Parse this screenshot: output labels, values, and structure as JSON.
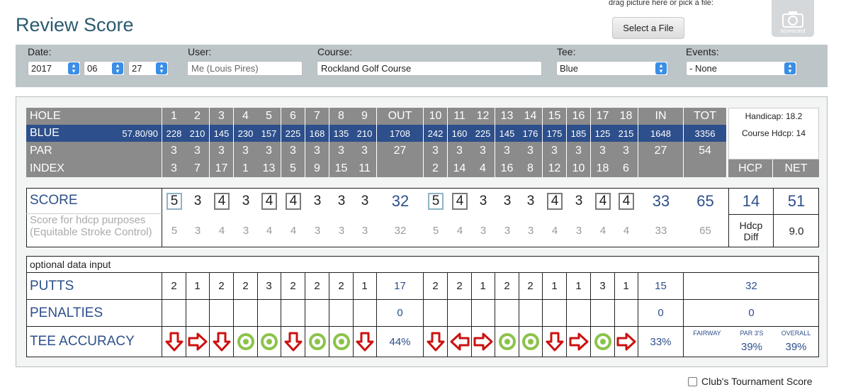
{
  "page": {
    "title": "Review Score"
  },
  "upload": {
    "drag_text": "drag picture here or pick a file:",
    "select_label": "Select a File",
    "camera_label": "scorecard"
  },
  "filters": {
    "date_label": "Date:",
    "year": "2017",
    "month": "06",
    "day": "27",
    "user_label": "User:",
    "user_value": "Me (Louis Pires)",
    "course_label": "Course:",
    "course_value": "Rockland Golf Course",
    "tee_label": "Tee:",
    "tee_value": "Blue",
    "events_label": "Events:",
    "events_value": "- None"
  },
  "card": {
    "hole_label": "HOLE",
    "holes_front": [
      "1",
      "2",
      "3",
      "4",
      "5",
      "6",
      "7",
      "8",
      "9"
    ],
    "out_label": "OUT",
    "holes_back": [
      "10",
      "11",
      "12",
      "13",
      "14",
      "15",
      "16",
      "17",
      "18"
    ],
    "in_label": "IN",
    "tot_label": "TOT",
    "tee_label": "BLUE",
    "rating": "57.80/90",
    "yards_front": [
      "228",
      "210",
      "145",
      "230",
      "157",
      "225",
      "168",
      "135",
      "210"
    ],
    "yards_out": "1708",
    "yards_back": [
      "242",
      "160",
      "225",
      "145",
      "176",
      "175",
      "185",
      "125",
      "215"
    ],
    "yards_in": "1648",
    "yards_tot": "3356",
    "par_label": "PAR",
    "par_front": [
      "3",
      "3",
      "3",
      "3",
      "3",
      "3",
      "3",
      "3",
      "3"
    ],
    "par_out": "27",
    "par_back": [
      "3",
      "3",
      "3",
      "3",
      "3",
      "3",
      "3",
      "3",
      "3"
    ],
    "par_in": "27",
    "par_tot": "54",
    "index_label": "INDEX",
    "index_front": [
      "3",
      "7",
      "17",
      "1",
      "13",
      "5",
      "9",
      "15",
      "11"
    ],
    "index_back": [
      "2",
      "14",
      "4",
      "16",
      "8",
      "12",
      "10",
      "18",
      "6"
    ],
    "handicap": "Handicap: 18.2",
    "course_hdcp": "Course Hdcp: 14",
    "hcp_label": "HCP",
    "net_label": "NET"
  },
  "score": {
    "label": "SCORE",
    "front": [
      "5",
      "3",
      "4",
      "3",
      "4",
      "4",
      "3",
      "3",
      "3"
    ],
    "out": "32",
    "back": [
      "5",
      "4",
      "3",
      "3",
      "3",
      "4",
      "3",
      "4",
      "4"
    ],
    "in": "33",
    "tot": "65",
    "hcp": "14",
    "net": "51",
    "hdcp_label_1": "Score for hdcp purposes",
    "hdcp_label_2": "(Equitable Stroke Control)",
    "esc_front": [
      "5",
      "3",
      "4",
      "3",
      "4",
      "4",
      "3",
      "3",
      "3"
    ],
    "esc_out": "32",
    "esc_back": [
      "5",
      "4",
      "3",
      "3",
      "3",
      "4",
      "3",
      "4",
      "4"
    ],
    "esc_in": "33",
    "esc_tot": "65",
    "hdcp_diff_label_1": "Hdcp",
    "hdcp_diff_label_2": "Diff",
    "hdcp_diff": "9.0",
    "box_styles_front": [
      "birdie",
      "none",
      "box",
      "none",
      "box",
      "box",
      "none",
      "none",
      "none"
    ],
    "box_styles_back": [
      "birdie",
      "box",
      "none",
      "none",
      "none",
      "box",
      "none",
      "box",
      "box"
    ]
  },
  "optional": {
    "header": "optional data input",
    "putts_label": "PUTTS",
    "putts_front": [
      "2",
      "1",
      "2",
      "2",
      "3",
      "2",
      "2",
      "2",
      "1"
    ],
    "putts_out": "17",
    "putts_back": [
      "2",
      "2",
      "1",
      "2",
      "2",
      "1",
      "1",
      "3",
      "1"
    ],
    "putts_in": "15",
    "putts_tot": "32",
    "penalties_label": "PENALTIES",
    "pen_out": "0",
    "pen_in": "0",
    "pen_tot": "0",
    "tee_acc_label": "TEE ACCURACY",
    "acc_front": [
      "down",
      "right",
      "down",
      "hit",
      "hit",
      "down",
      "hit",
      "hit",
      "down"
    ],
    "acc_out": "44%",
    "acc_back": [
      "down",
      "left",
      "right",
      "hit",
      "hit",
      "down",
      "right",
      "hit",
      "right"
    ],
    "acc_in": "33%",
    "fairway_label": "FAIRWAY",
    "par3_label": "PAR 3'S",
    "par3_value": "39%",
    "overall_label": "OVERALL",
    "overall_value": "39%"
  },
  "tournament": {
    "label": "Club's Tournament Score"
  },
  "colors": {
    "accent_blue": "#2d4f8b",
    "arrow_red": "#cc1111",
    "target_green": "#8bc34a"
  }
}
